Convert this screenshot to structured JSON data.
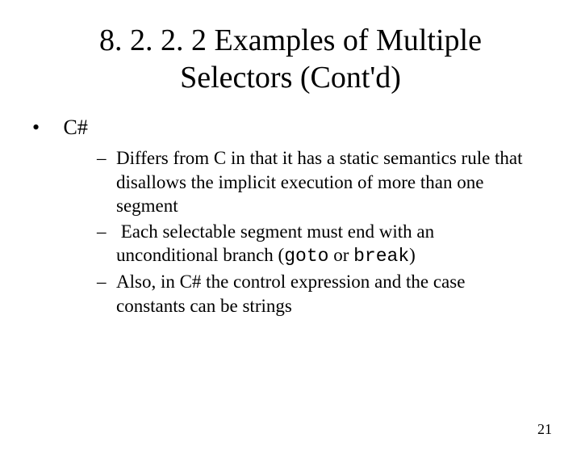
{
  "title_line1": "8. 2. 2. 2 Examples of Multiple",
  "title_line2": "Selectors (Cont'd)",
  "bullet1": "C#",
  "sub1": "Differs from C in that it has a static semantics rule that disallows the implicit execution of more than one segment",
  "sub2_a": "Each selectable segment must end with an unconditional branch (",
  "sub2_goto": "goto",
  "sub2_mid": " or ",
  "sub2_break": "break",
  "sub2_b": ")",
  "sub3": "Also, in C# the control expression and the case constants can be strings",
  "page_number": "21"
}
